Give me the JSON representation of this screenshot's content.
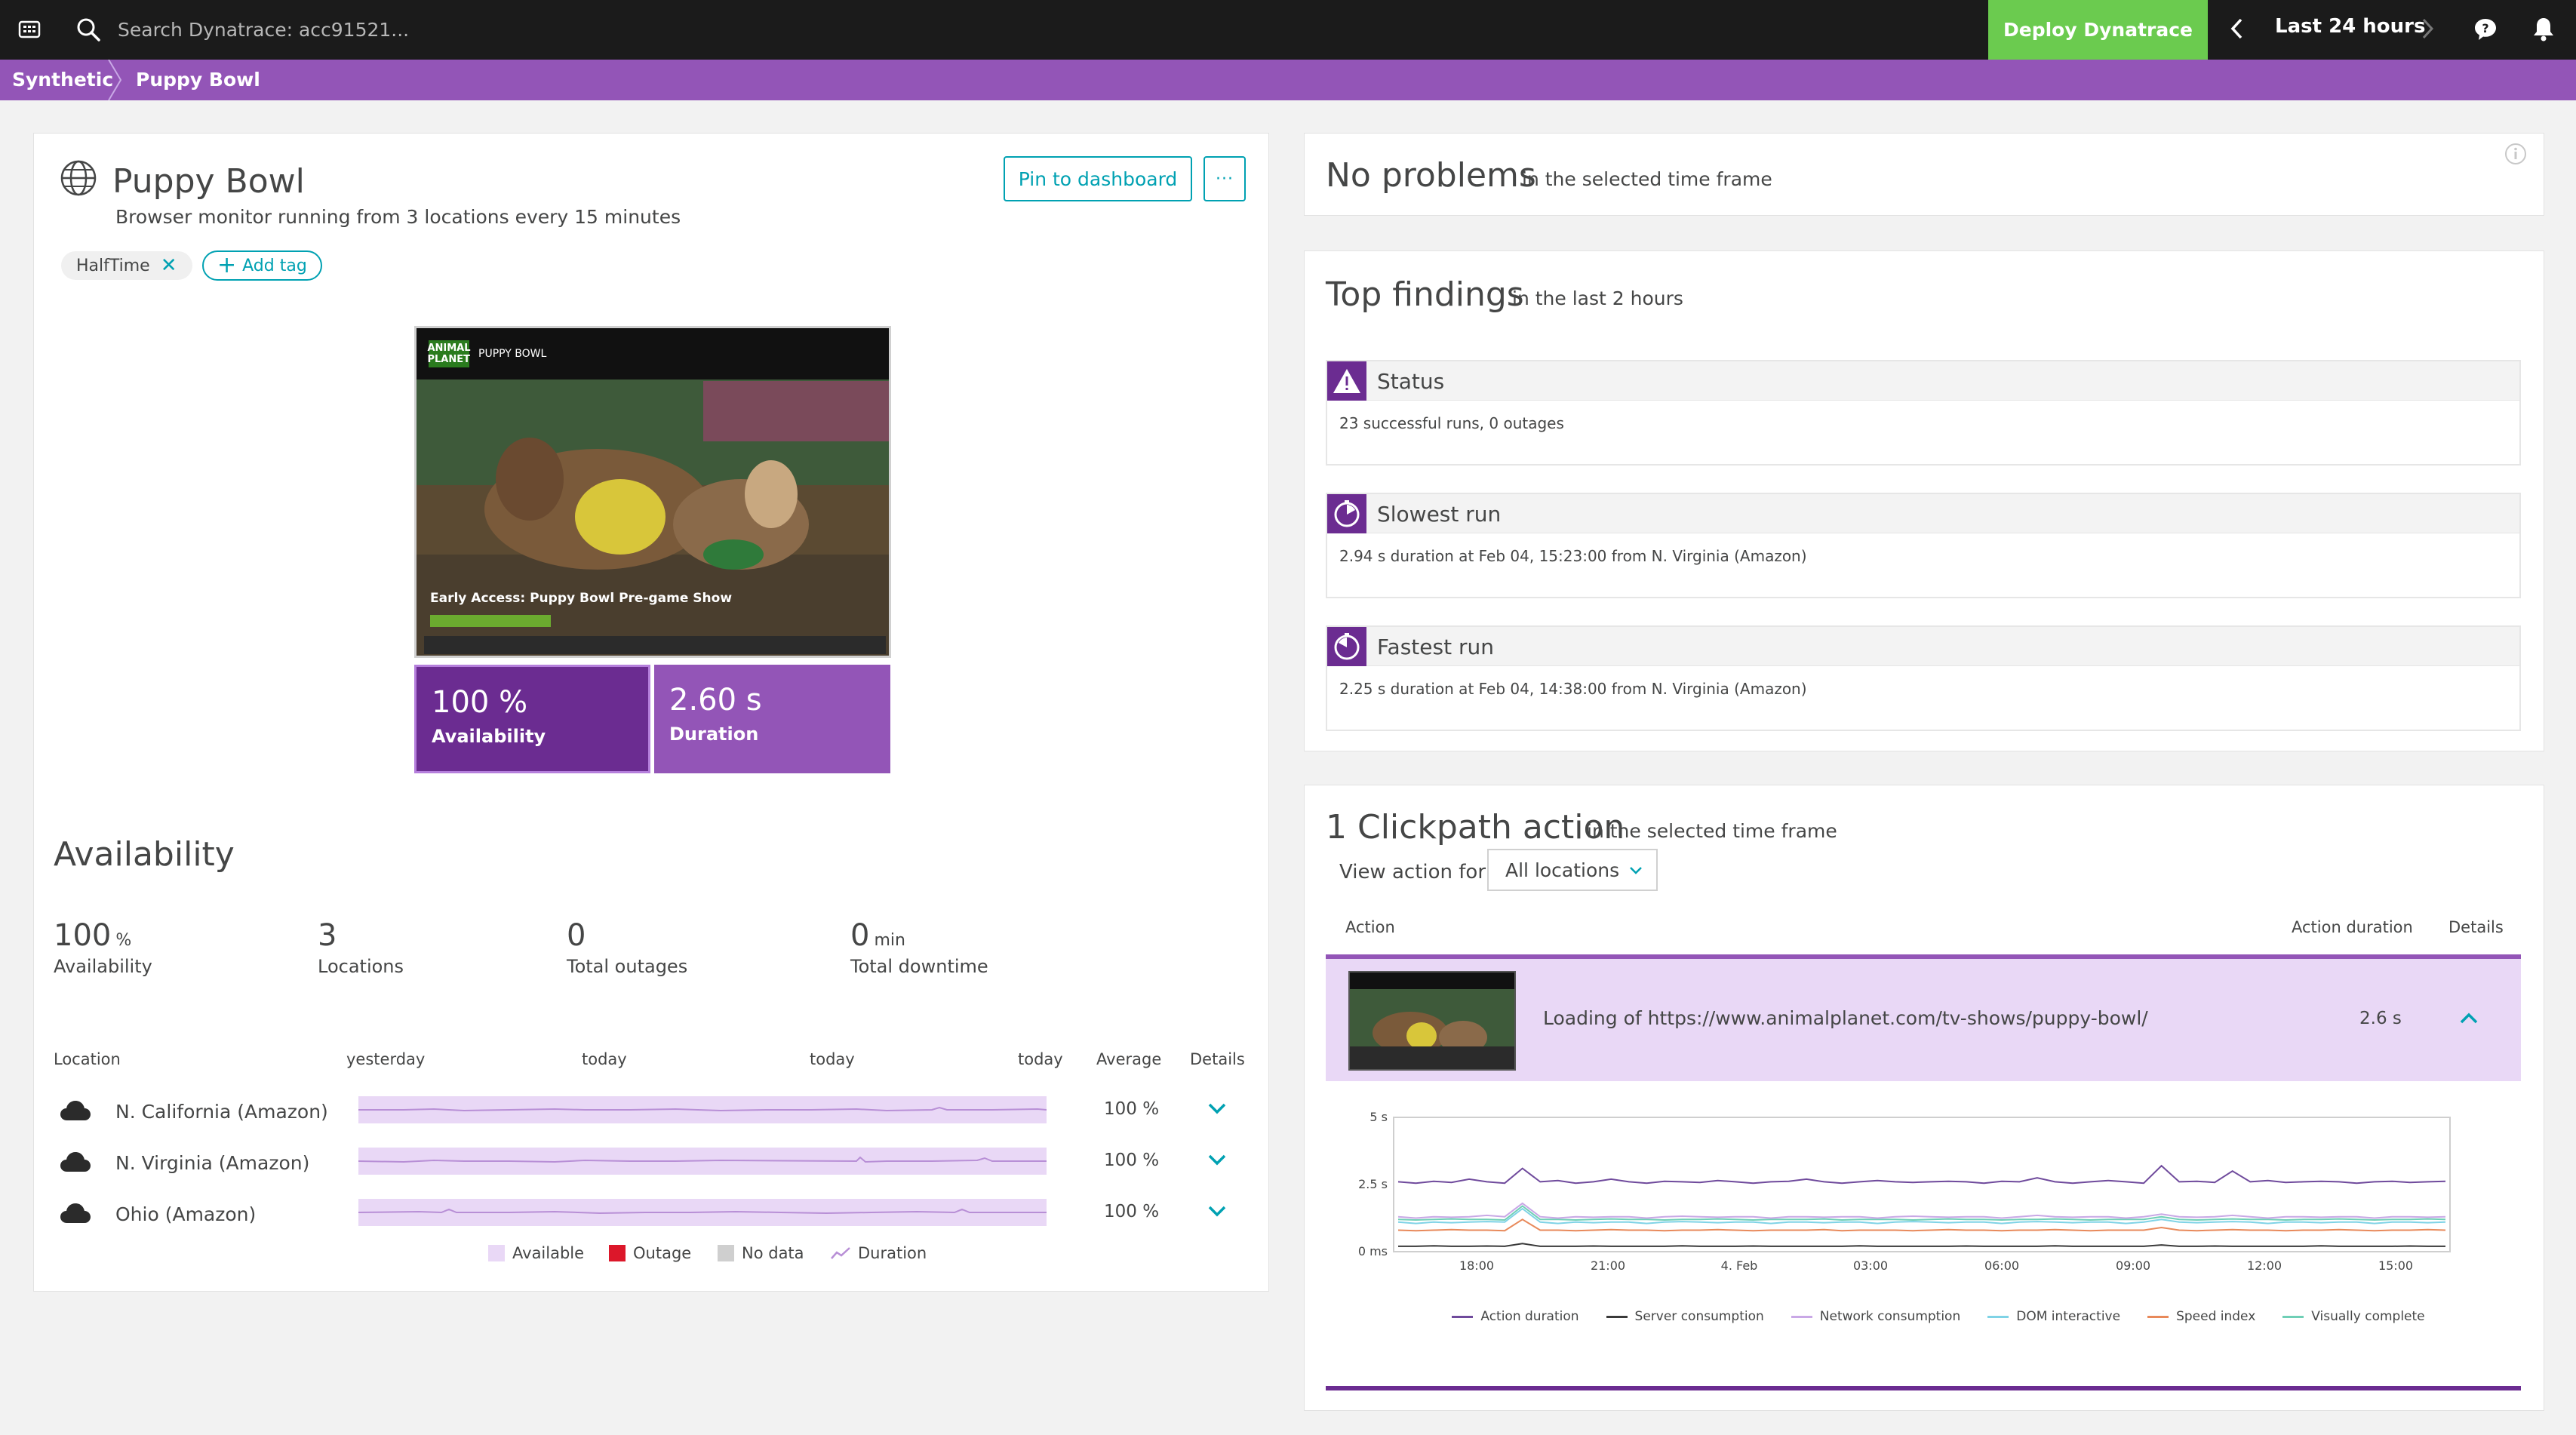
{
  "topbar": {
    "search_placeholder": "Search Dynatrace: acc91521...",
    "deploy_label": "Deploy Dynatrace",
    "timeframe_label": "Last 24 hours"
  },
  "breadcrumb": {
    "items": [
      {
        "label": "Synthetic"
      },
      {
        "label": "Puppy Bowl"
      }
    ]
  },
  "monitor": {
    "title": "Puppy Bowl",
    "subtitle": "Browser monitor running from 3 locations every 15 minutes",
    "pin_label": "Pin to dashboard",
    "more_label": "···",
    "tag": "HalfTime",
    "add_tag_label": "Add tag",
    "screenshot": {
      "brand": "PUPPY BOWL",
      "logo": "ANIMAL PLANET",
      "caption": "Early Access: Puppy Bowl Pre-game Show"
    },
    "tiles": [
      {
        "value": "100 %",
        "label": "Availability"
      },
      {
        "value": "2.60 s",
        "label": "Duration"
      }
    ]
  },
  "availability": {
    "heading": "Availability",
    "kpis": [
      {
        "value": "100",
        "unit": "%",
        "label": "Availability"
      },
      {
        "value": "3",
        "unit": "",
        "label": "Locations"
      },
      {
        "value": "0",
        "unit": "",
        "label": "Total outages"
      },
      {
        "value": "0",
        "unit": "min",
        "label": "Total downtime"
      }
    ],
    "columns": {
      "location": "Location",
      "t1": "yesterday",
      "t2": "today",
      "t3": "today",
      "t4": "today",
      "average": "Average",
      "details": "Details"
    },
    "rows": [
      {
        "name": "N. California (Amazon)",
        "average": "100 %"
      },
      {
        "name": "N. Virginia (Amazon)",
        "average": "100 %"
      },
      {
        "name": "Ohio (Amazon)",
        "average": "100 %"
      }
    ],
    "legend": {
      "available": "Available",
      "outage": "Outage",
      "nodata": "No data",
      "duration": "Duration"
    }
  },
  "problems": {
    "title": "No problems",
    "sub": "in the selected time frame"
  },
  "findings": {
    "title": "Top findings",
    "sub": "in the last 2 hours",
    "items": [
      {
        "title": "Status",
        "detail": "23 successful runs, 0 outages",
        "icon": "warning-icon"
      },
      {
        "title": "Slowest run",
        "detail": "2.94 s duration at Feb 04, 15:23:00 from N. Virginia (Amazon)",
        "icon": "clock-icon"
      },
      {
        "title": "Fastest run",
        "detail": "2.25 s duration at Feb 04, 14:38:00 from N. Virginia (Amazon)",
        "icon": "clock-icon"
      }
    ]
  },
  "clickpath": {
    "title": "1 Clickpath action",
    "sub": "in the selected time frame",
    "view_label": "View action for",
    "select_value": "All locations",
    "columns": {
      "action": "Action",
      "duration": "Action duration",
      "details": "Details"
    },
    "action": {
      "name": "Loading of https://www.animalplanet.com/tv-shows/puppy-bowl/",
      "duration": "2.6 s"
    }
  },
  "colors": {
    "purple_dark": "#6b2c91",
    "purple": "#9355b7",
    "green": "#6bcb4f",
    "teal": "#00a1b2"
  },
  "chart_data": {
    "type": "line",
    "x_ticks": [
      "18:00",
      "21:00",
      "4. Feb",
      "03:00",
      "06:00",
      "09:00",
      "12:00",
      "15:00"
    ],
    "y_ticks": [
      "0 ms",
      "2.5 s",
      "5 s"
    ],
    "ylim": [
      0,
      5
    ],
    "series": [
      {
        "name": "Action duration",
        "color": "#6f4a9c",
        "values": [
          2.6,
          2.55,
          2.62,
          2.58,
          2.7,
          2.6,
          2.55,
          3.1,
          2.6,
          2.65,
          2.55,
          2.6,
          2.7,
          2.6,
          2.55,
          2.62,
          2.6,
          2.58,
          2.65,
          2.6,
          2.55,
          2.6,
          2.62,
          2.7,
          2.6,
          2.55,
          2.6,
          2.65,
          2.6,
          2.58,
          2.6,
          2.62,
          2.6,
          2.55,
          2.62,
          2.6,
          2.75,
          2.6,
          2.55,
          2.6,
          2.65,
          2.6,
          2.55,
          3.2,
          2.6,
          2.62,
          2.58,
          3.0,
          2.6,
          2.65,
          2.58,
          2.6,
          2.62,
          2.6,
          2.55,
          2.6,
          2.62,
          2.58,
          2.6,
          2.62
        ]
      },
      {
        "name": "Server consumption",
        "color": "#3a3a3a",
        "values": [
          0.2,
          0.2,
          0.22,
          0.2,
          0.2,
          0.21,
          0.2,
          0.3,
          0.2,
          0.2,
          0.2,
          0.21,
          0.2,
          0.2,
          0.2,
          0.2,
          0.22,
          0.2,
          0.2,
          0.2,
          0.21,
          0.2,
          0.2,
          0.2,
          0.2,
          0.2,
          0.22,
          0.2,
          0.2,
          0.2,
          0.2,
          0.2,
          0.21,
          0.2,
          0.2,
          0.2,
          0.2,
          0.22,
          0.2,
          0.2,
          0.2,
          0.2,
          0.2,
          0.25,
          0.2,
          0.2,
          0.21,
          0.2,
          0.2,
          0.2,
          0.2,
          0.2,
          0.22,
          0.2,
          0.2,
          0.2,
          0.2,
          0.21,
          0.2,
          0.2
        ]
      },
      {
        "name": "Network consumption",
        "color": "#c9a8e6",
        "values": [
          1.3,
          1.25,
          1.3,
          1.28,
          1.3,
          1.35,
          1.3,
          1.8,
          1.3,
          1.25,
          1.3,
          1.28,
          1.3,
          1.3,
          1.25,
          1.3,
          1.32,
          1.3,
          1.28,
          1.3,
          1.3,
          1.25,
          1.3,
          1.3,
          1.28,
          1.3,
          1.3,
          1.25,
          1.3,
          1.32,
          1.3,
          1.28,
          1.3,
          1.3,
          1.25,
          1.3,
          1.35,
          1.3,
          1.28,
          1.3,
          1.3,
          1.25,
          1.3,
          1.4,
          1.3,
          1.28,
          1.3,
          1.35,
          1.3,
          1.25,
          1.3,
          1.3,
          1.28,
          1.3,
          1.3,
          1.25,
          1.3,
          1.3,
          1.28,
          1.3
        ]
      },
      {
        "name": "DOM interactive",
        "color": "#7fd3e6",
        "values": [
          1.1,
          1.05,
          1.1,
          1.08,
          1.1,
          1.12,
          1.1,
          1.6,
          1.1,
          1.05,
          1.1,
          1.08,
          1.1,
          1.1,
          1.05,
          1.1,
          1.12,
          1.1,
          1.08,
          1.1,
          1.1,
          1.05,
          1.1,
          1.1,
          1.08,
          1.1,
          1.1,
          1.05,
          1.1,
          1.12,
          1.1,
          1.08,
          1.1,
          1.1,
          1.05,
          1.1,
          1.12,
          1.1,
          1.08,
          1.1,
          1.1,
          1.05,
          1.1,
          1.2,
          1.1,
          1.08,
          1.1,
          1.12,
          1.1,
          1.05,
          1.1,
          1.1,
          1.08,
          1.1,
          1.1,
          1.05,
          1.1,
          1.1,
          1.08,
          1.1
        ]
      },
      {
        "name": "Speed index",
        "color": "#e8895a",
        "values": [
          0.8,
          0.78,
          0.8,
          0.82,
          0.8,
          0.8,
          0.78,
          1.2,
          0.8,
          0.8,
          0.78,
          0.8,
          0.82,
          0.8,
          0.8,
          0.78,
          0.8,
          0.8,
          0.82,
          0.8,
          0.78,
          0.8,
          0.8,
          0.8,
          0.82,
          0.78,
          0.8,
          0.8,
          0.8,
          0.78,
          0.8,
          0.82,
          0.8,
          0.8,
          0.78,
          0.8,
          0.8,
          0.82,
          0.8,
          0.78,
          0.8,
          0.8,
          0.8,
          0.9,
          0.8,
          0.78,
          0.8,
          0.82,
          0.8,
          0.8,
          0.78,
          0.8,
          0.8,
          0.82,
          0.8,
          0.78,
          0.8,
          0.8,
          0.82,
          0.8
        ]
      },
      {
        "name": "Visually complete",
        "color": "#6fcfb6",
        "values": [
          1.2,
          1.18,
          1.2,
          1.22,
          1.2,
          1.2,
          1.18,
          1.7,
          1.2,
          1.2,
          1.18,
          1.2,
          1.22,
          1.2,
          1.2,
          1.18,
          1.2,
          1.2,
          1.22,
          1.2,
          1.18,
          1.2,
          1.2,
          1.2,
          1.22,
          1.18,
          1.2,
          1.2,
          1.2,
          1.18,
          1.2,
          1.22,
          1.2,
          1.2,
          1.18,
          1.2,
          1.2,
          1.22,
          1.2,
          1.18,
          1.2,
          1.2,
          1.2,
          1.3,
          1.2,
          1.18,
          1.2,
          1.22,
          1.2,
          1.2,
          1.18,
          1.2,
          1.2,
          1.22,
          1.2,
          1.18,
          1.2,
          1.2,
          1.22,
          1.2
        ]
      }
    ]
  }
}
